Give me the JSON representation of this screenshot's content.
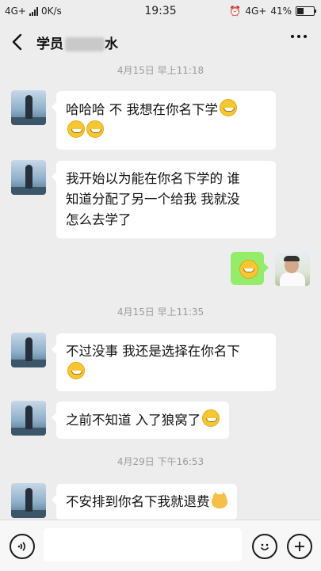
{
  "status": {
    "network": "4G+",
    "speed": "0K/s",
    "time": "19:35",
    "network_right": "4G+",
    "battery": "41%",
    "battery_level": 0.41
  },
  "header": {
    "title": "学员",
    "title_suffix": "水",
    "back_icon": "chevron-left-icon",
    "more_icon": "more-dots-icon"
  },
  "chat": {
    "timestamps": [
      "4月15日 早上11:18",
      "4月15日 早上11:35",
      "4月29日 下午16:53"
    ],
    "messages": [
      {
        "text": "哈哈哈  不  我想在你名下学",
        "emoji": "grin-emoji"
      },
      {
        "line1": "我开始以为能在你名下学的  谁",
        "line2": "知道分配了另一个给我  我就没",
        "line3": "怎么去学了"
      },
      {
        "emoji": "crying-emoji"
      },
      {
        "line1": "不过没事  我还是选择在你名下",
        "emoji": "smile-emoji"
      },
      {
        "text": "之前不知道  入了狼窝了",
        "emoji": "crying-emoji"
      },
      {
        "text": "不安排到你名下我就退费",
        "emoji": "cat-emoji"
      }
    ]
  },
  "input": {
    "voice_icon": "voice-icon",
    "emoji_icon": "emoji-icon",
    "plus_icon": "plus-icon"
  }
}
